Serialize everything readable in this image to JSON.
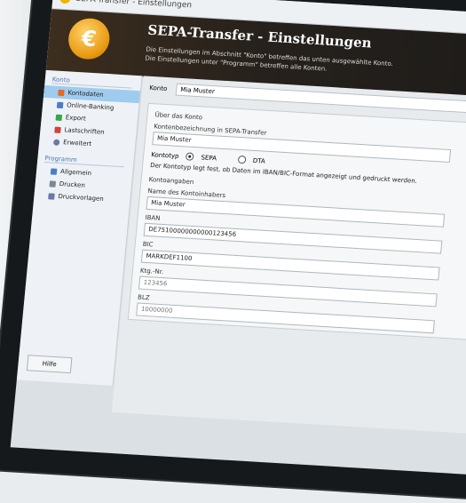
{
  "window": {
    "title": "SEPA-Transfer - Einstellungen"
  },
  "banner": {
    "title": "SEPA-Transfer - Einstellungen",
    "desc1": "Die Einstellungen im Abschnitt \"Konto\" betreffen das unten ausgewählte Konto.",
    "desc2": "Die Einstellungen unter \"Programm\" betreffen alle Konten."
  },
  "sidebar": {
    "group_konto": "Konto",
    "konto_items": [
      {
        "label": "Kontodaten",
        "color": "#e06b2b"
      },
      {
        "label": "Online-Banking",
        "color": "#4a7fc8"
      },
      {
        "label": "Export",
        "color": "#35a845"
      },
      {
        "label": "Lastschriften",
        "color": "#d2443b"
      },
      {
        "label": "Erweitert",
        "color": "#6a7aa0"
      }
    ],
    "group_programm": "Programm",
    "programm_items": [
      {
        "label": "Allgemein",
        "color": "#4a7fc8"
      },
      {
        "label": "Drucken",
        "color": "#7c8894"
      },
      {
        "label": "Druckvorlagen",
        "color": "#6a7aa0"
      }
    ],
    "help": "Hilfe"
  },
  "main": {
    "konto_label": "Konto",
    "konto_value": "Mia Muster",
    "about_group": "Über das Konto",
    "name_label": "Kontenbezeichnung in SEPA-Transfer",
    "name_value": "Mia Muster",
    "typ_label": "Kontotyp",
    "radio_sepa": "SEPA",
    "radio_dta": "DTA",
    "typ_note": "Der Kontotyp legt fest, ob Daten im IBAN/BIC-Format angezeigt und gedruckt werden.",
    "angaben_group": "Kontoangaben",
    "inhaber_label": "Name des Kontoinhabers",
    "inhaber_value": "Mia Muster",
    "iban_label": "IBAN",
    "iban_value": "DE75100000000000123456",
    "bic_label": "BIC",
    "bic_value": "MARKDEF1100",
    "ktonr_label": "Ktg.-Nr.",
    "ktonr_value": "123456",
    "blz_label": "BLZ",
    "blz_value": "10000000"
  }
}
